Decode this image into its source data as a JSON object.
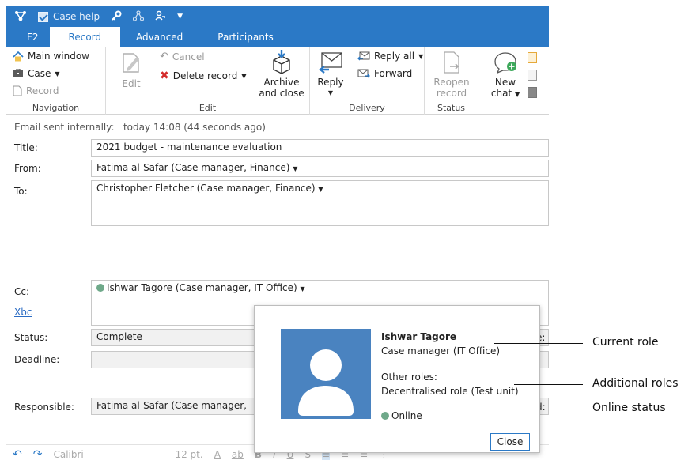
{
  "titlebar": {
    "title": "Case help"
  },
  "tabs": [
    {
      "label": "F2"
    },
    {
      "label": "Record"
    },
    {
      "label": "Advanced"
    },
    {
      "label": "Participants"
    }
  ],
  "ribbon": {
    "navigation": {
      "label": "Navigation",
      "main_window": "Main window",
      "case": "Case",
      "record": "Record"
    },
    "edit": {
      "label": "Edit",
      "edit": "Edit",
      "cancel": "Cancel",
      "delete_record": "Delete record",
      "archive_line1": "Archive",
      "archive_line2": "and close"
    },
    "delivery": {
      "label": "Delivery",
      "reply": "Reply",
      "reply_all": "Reply all",
      "forward": "Forward"
    },
    "status": {
      "label": "Status",
      "reopen_line1": "Reopen",
      "reopen_line2": "record"
    },
    "chat": {
      "new_line1": "New",
      "new_line2": "chat"
    }
  },
  "form": {
    "sent_info": "Email sent internally:",
    "sent_time": "today 14:08 (44 seconds ago)",
    "title_label": "Title:",
    "title_value": "2021 budget - maintenance evaluation",
    "from_label": "From:",
    "from_value": "Fatima al-Safar (Case manager, Finance)",
    "to_label": "To:",
    "to_value": "Christopher Fletcher (Case manager, Finance)",
    "cc_label": "Cc:",
    "cc_value": "Ishwar Tagore (Case manager, IT Office)",
    "bcc_link": "Xbc",
    "status_label": "Status:",
    "status_value": "Complete",
    "deadline_label": "Deadline:",
    "responsible_label": "Responsible:",
    "responsible_value": "Fatima al-Safar (Case manager,",
    "right_cut1": "e:",
    "right_cut2": "d:"
  },
  "toolbar": {
    "font": "Calibri",
    "size": "12 pt."
  },
  "popup": {
    "name": "Ishwar Tagore",
    "role": "Case manager (IT Office)",
    "other_roles_label": "Other roles:",
    "other_role": "Decentralised role (Test unit)",
    "status": "Online",
    "close": "Close",
    "avatar_color": "#4a83c0",
    "online_color": "#6fa98a"
  },
  "annotations": {
    "current_role": "Current role",
    "additional_roles": "Additional roles",
    "online_status": "Online status"
  }
}
